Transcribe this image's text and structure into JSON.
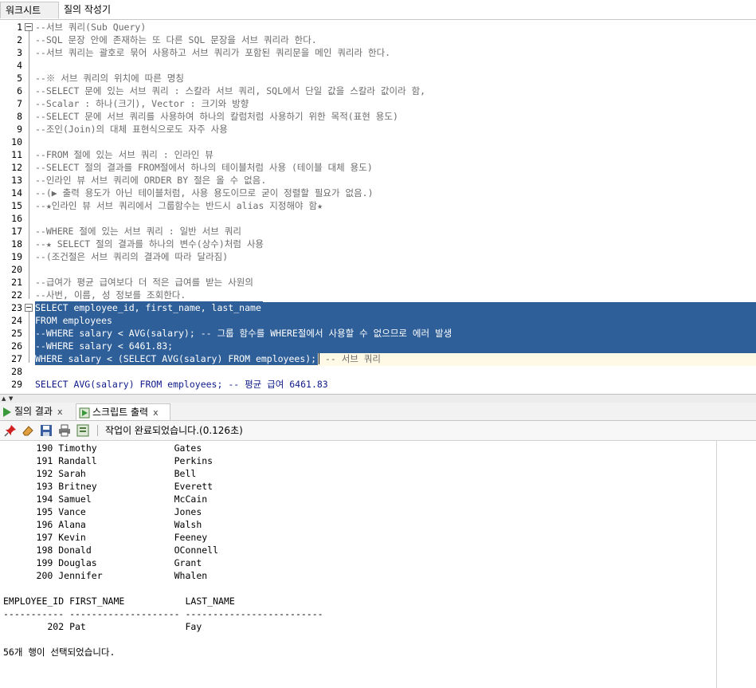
{
  "top_tabs": [
    "워크시트",
    "질의 작성기"
  ],
  "editor": {
    "lines": [
      {
        "n": "1",
        "text": "--서브 쿼리(Sub Query)",
        "kind": "comment"
      },
      {
        "n": "2",
        "text": "--SQL 문장 안에 존재하는 또 다른 SQL 문장을 서브 쿼리라 한다.",
        "kind": "comment"
      },
      {
        "n": "3",
        "text": "--서브 쿼리는 괄호로 묶어 사용하고 서브 쿼리가 포함된 쿼리문을 메인 쿼리라 한다.",
        "kind": "comment"
      },
      {
        "n": "4",
        "text": "",
        "kind": "comment"
      },
      {
        "n": "5",
        "text": "--※ 서브 쿼리의 위치에 따른 명칭",
        "kind": "comment"
      },
      {
        "n": "6",
        "text": "--SELECT 문에 있는 서브 쿼리 : 스칼라 서브 쿼리, SQL에서 단일 값을 스칼라 값이라 함,",
        "kind": "comment"
      },
      {
        "n": "7",
        "text": "--Scalar : 하나(크기), Vector : 크기와 방향",
        "kind": "comment"
      },
      {
        "n": "8",
        "text": "--SELECT 문에 서브 쿼리를 사용하여 하나의 칼럼처럼 사용하기 위한 목적(표현 용도)",
        "kind": "comment"
      },
      {
        "n": "9",
        "text": "--조인(Join)의 대체 표현식으로도 자주 사용",
        "kind": "comment"
      },
      {
        "n": "10",
        "text": "",
        "kind": "comment"
      },
      {
        "n": "11",
        "text": "--FROM 절에 있는 서브 쿼리 : 인라인 뷰",
        "kind": "comment"
      },
      {
        "n": "12",
        "text": "--SELECT 절의 결과를 FROM절에서 하나의 테이블처럼 사용 (테이블 대체 용도)",
        "kind": "comment"
      },
      {
        "n": "13",
        "text": "--인라인 뷰 서브 쿼리에 ORDER BY 절은 올 수 없음.",
        "kind": "comment"
      },
      {
        "n": "14",
        "text": "--(▶ 출력 용도가 아닌 테이블처럼, 사용 용도이므로 굳이 정렬할 필요가 없음.)",
        "kind": "comment"
      },
      {
        "n": "15",
        "text": "--★인라인 뷰 서브 쿼리에서 그룹함수는 반드시 alias 지정해야 함★",
        "kind": "comment"
      },
      {
        "n": "16",
        "text": "",
        "kind": "comment"
      },
      {
        "n": "17",
        "text": "--WHERE 절에 있는 서브 쿼리 : 일반 서브 쿼리",
        "kind": "comment"
      },
      {
        "n": "18",
        "text": "--★ SELECT 절의 결과를 하나의 변수(상수)처럼 사용",
        "kind": "comment"
      },
      {
        "n": "19",
        "text": "--(조건절은 서브 쿼리의 결과에 따라 달라짐)",
        "kind": "comment"
      },
      {
        "n": "20",
        "text": "",
        "kind": "comment"
      },
      {
        "n": "21",
        "text": "--급여가 평균 급여보다 더 적은 급여를 받는 사원의",
        "kind": "comment"
      },
      {
        "n": "22",
        "text": "--사번, 이름, 성 정보를 조회한다.",
        "kind": "comment"
      },
      {
        "n": "23",
        "text": "SELECT employee_id, first_name, last_name",
        "kind": "sel"
      },
      {
        "n": "24",
        "text": "FROM employees",
        "kind": "sel"
      },
      {
        "n": "25",
        "text": "--WHERE salary < AVG(salary); -- 그룹 함수를 WHERE절에서 사용할 수 없으므로 에러 발생",
        "kind": "sel"
      },
      {
        "n": "26",
        "text": "--WHERE salary < 6461.83;",
        "kind": "sel"
      },
      {
        "n": "27",
        "text": "WHERE salary < (SELECT AVG(salary) FROM employees);",
        "kind": "sel"
      },
      {
        "n": "28",
        "text": "",
        "kind": "comment"
      },
      {
        "n": "29",
        "text": "SELECT AVG(salary) FROM employees; -- 평균 급여 6461.83",
        "kind": "sql"
      }
    ],
    "line27_tail": " -- 서브 쿼리"
  },
  "result_tabs": [
    {
      "label": "질의 결과",
      "close": "x",
      "icon": "play-icon"
    },
    {
      "label": "스크립트 출력",
      "close": "x",
      "icon": "script-icon"
    }
  ],
  "toolbar": {
    "status": "작업이 완료되었습니다.(0.126초)",
    "icons": [
      "pin-icon",
      "eraser-icon",
      "save-icon",
      "print-icon",
      "export-icon"
    ]
  },
  "output": {
    "lines": [
      "      190 Timothy              Gates",
      "      191 Randall              Perkins",
      "      192 Sarah                Bell",
      "      193 Britney              Everett",
      "      194 Samuel               McCain",
      "      195 Vance                Jones",
      "      196 Alana                Walsh",
      "      197 Kevin                Feeney",
      "      198 Donald               OConnell",
      "      199 Douglas              Grant",
      "      200 Jennifer             Whalen",
      "",
      "EMPLOYEE_ID FIRST_NAME           LAST_NAME",
      "----------- -------------------- -------------------------",
      "        202 Pat                  Fay",
      "",
      "56개 행이 선택되었습니다."
    ]
  }
}
